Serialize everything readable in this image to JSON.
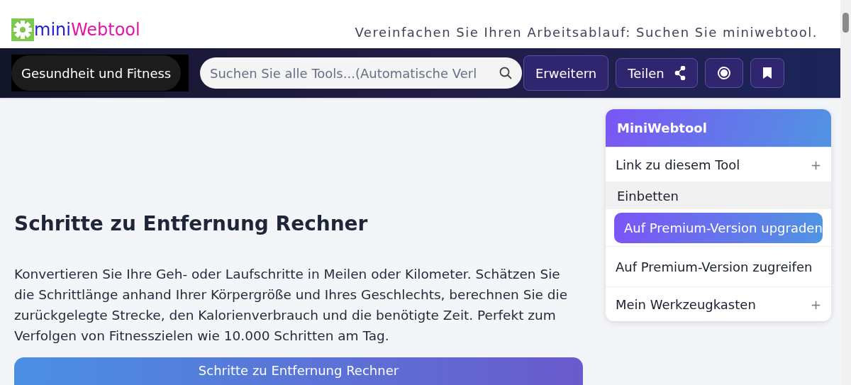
{
  "header": {
    "logo": {
      "part_1": "mini",
      "part_2": "Webtool"
    },
    "tagline": "Vereinfachen Sie Ihren Arbeitsablauf: Suchen Sie miniwebtool."
  },
  "navbar": {
    "category": "Gesundheit und Fitness",
    "search": {
      "placeholder": "Suchen Sie alle Tools...(Automatische Verl"
    },
    "expand_button": "Erweitern",
    "share_button": "Teilen"
  },
  "main": {
    "title": "Schritte zu Entfernung Rechner",
    "description": "Konvertieren Sie Ihre Geh- oder Laufschritte in Meilen oder Kilometer. Schätzen Sie die Schrittlänge anhand Ihrer Körpergröße und Ihres Geschlechts, berechnen Sie die zurückgelegte Strecke, den Kalorienverbrauch und die benötigte Zeit. Perfekt zum Verfolgen von Fitnesszielen wie 10.000 Schritten am Tag.",
    "card_title": "Schritte zu Entfernung Rechner"
  },
  "sidebar": {
    "title": "MiniWebtool",
    "items": [
      {
        "label": "Link zu diesem Tool",
        "kind": "expandable",
        "plus": "+",
        "selected": false
      },
      {
        "label": "Einbetten",
        "kind": "compact",
        "selected": true
      },
      {
        "label": "Auf Premium-Version upgraden",
        "kind": "premium",
        "selected": false
      },
      {
        "label": "Auf Premium-Version zugreifen",
        "kind": "plain",
        "selected": false
      },
      {
        "label": "Mein Werkzeugkasten",
        "kind": "expandable",
        "plus": "+",
        "selected": false
      }
    ]
  }
}
